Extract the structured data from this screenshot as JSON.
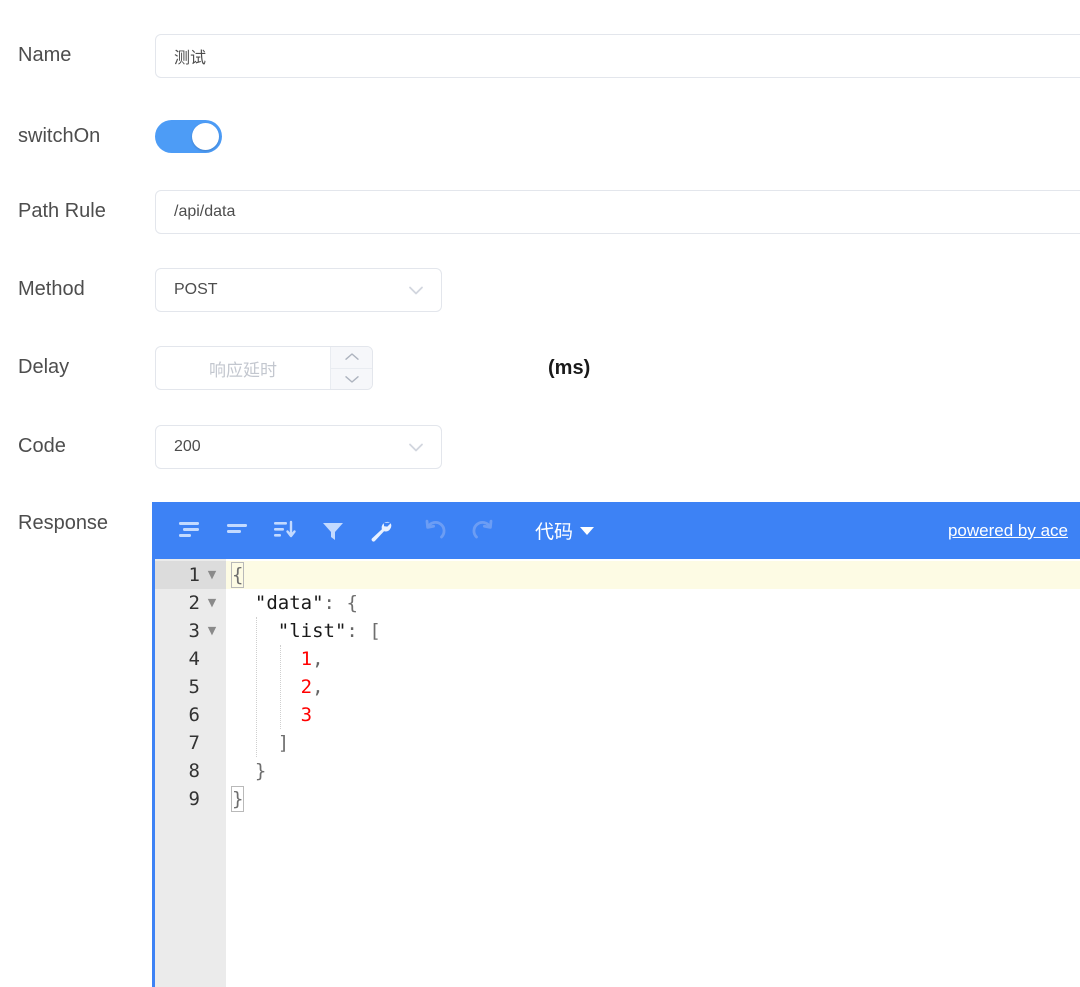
{
  "form": {
    "rows": [
      {
        "label": "Name",
        "type": "text",
        "value": "测试"
      },
      {
        "label": "switchOn",
        "type": "switch",
        "value": "on"
      },
      {
        "label": "Path Rule",
        "type": "text",
        "value": "/api/data"
      },
      {
        "label": "Method",
        "type": "select",
        "value": "POST"
      },
      {
        "label": "Delay",
        "type": "number",
        "value": "",
        "placeholder": "响应延时",
        "unit": "(ms)"
      },
      {
        "label": "Code",
        "type": "select",
        "value": "200"
      },
      {
        "label": "Response",
        "type": "editor"
      }
    ]
  },
  "editor": {
    "toolbar": {
      "icons": [
        {
          "name": "format-indent-icon",
          "title": "格式化"
        },
        {
          "name": "compact-icon",
          "title": "压缩"
        },
        {
          "name": "sort-icon",
          "title": "排序"
        },
        {
          "name": "filter-icon",
          "title": "过滤"
        },
        {
          "name": "wrench-repair-icon",
          "title": "修复"
        },
        {
          "name": "undo-icon",
          "title": "撤销"
        },
        {
          "name": "redo-icon",
          "title": "重做"
        }
      ],
      "mode_label": "代码",
      "powered_by": "powered by ace",
      "bar_color": "#3d82f5"
    },
    "gutter": [
      {
        "num": "1",
        "foldable": true
      },
      {
        "num": "2",
        "foldable": true
      },
      {
        "num": "3",
        "foldable": true
      },
      {
        "num": "4",
        "foldable": false
      },
      {
        "num": "5",
        "foldable": false
      },
      {
        "num": "6",
        "foldable": false
      },
      {
        "num": "7",
        "foldable": false
      },
      {
        "num": "8",
        "foldable": false
      },
      {
        "num": "9",
        "foldable": false
      }
    ],
    "active_line": 1,
    "content_lines": [
      "{",
      "  \"data\": {",
      "    \"list\": [",
      "      1,",
      "      2,",
      "      3",
      "    ]",
      "  }",
      "}"
    ],
    "value_text": "{\n  \"data\": {\n    \"list\": [\n      1,\n      2,\n      3\n    ]\n  }\n}",
    "colors": {
      "number_token": "#ff0000",
      "string_token": "#1a1a1a",
      "active_line_bg": "#fdfbe4",
      "gutter_bg": "#ebebeb"
    }
  }
}
